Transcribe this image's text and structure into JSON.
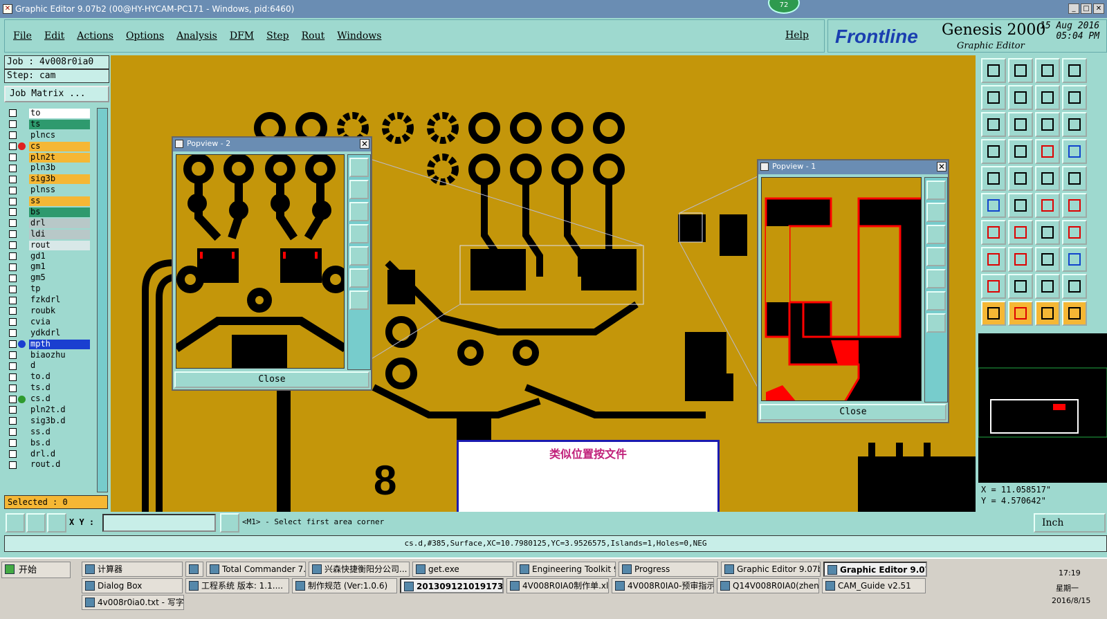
{
  "window": {
    "title": "Graphic Editor 9.07b2 (00@HY-HYCAM-PC171 - Windows, pid:6460)",
    "badge": "72"
  },
  "menu": {
    "items": [
      "File",
      "Edit",
      "Actions",
      "Options",
      "Analysis",
      "DFM",
      "Step",
      "Rout",
      "Windows"
    ],
    "help": "Help"
  },
  "brand": {
    "logo": "Frontline",
    "product": "Genesis 2000",
    "subtitle": "Graphic Editor",
    "date": "15 Aug 2016",
    "time": "05:04 PM"
  },
  "job": {
    "job_label": "Job : 4v008r0ia0",
    "step_label": "Step: cam",
    "matrix_button": "Job Matrix ..."
  },
  "layers": [
    {
      "name": "to",
      "color": "#ffffff",
      "dot": ""
    },
    {
      "name": "ts",
      "color": "#2e9a6e",
      "dot": ""
    },
    {
      "name": "plncs",
      "color": "#9ed9cf",
      "dot": ""
    },
    {
      "name": "cs",
      "color": "#f5b735",
      "dot": "#e02020"
    },
    {
      "name": "pln2t",
      "color": "#f5b735",
      "dot": ""
    },
    {
      "name": "pln3b",
      "color": "#9ed9cf",
      "dot": ""
    },
    {
      "name": "sig3b",
      "color": "#f5b735",
      "dot": ""
    },
    {
      "name": "plnss",
      "color": "#9ed9cf",
      "dot": ""
    },
    {
      "name": "ss",
      "color": "#f5b735",
      "dot": ""
    },
    {
      "name": "bs",
      "color": "#2e9a6e",
      "dot": ""
    },
    {
      "name": "drl",
      "color": "#b8c8c8",
      "dot": ""
    },
    {
      "name": "ldi",
      "color": "#b8c8c8",
      "dot": ""
    },
    {
      "name": "rout",
      "color": "#d8e8e8",
      "dot": ""
    },
    {
      "name": "gd1",
      "color": "#9ed9cf",
      "dot": ""
    },
    {
      "name": "gm1",
      "color": "#9ed9cf",
      "dot": ""
    },
    {
      "name": "gm5",
      "color": "#9ed9cf",
      "dot": ""
    },
    {
      "name": "tp",
      "color": "#9ed9cf",
      "dot": ""
    },
    {
      "name": "fzkdrl",
      "color": "#9ed9cf",
      "dot": ""
    },
    {
      "name": "roubk",
      "color": "#9ed9cf",
      "dot": ""
    },
    {
      "name": "cvia",
      "color": "#9ed9cf",
      "dot": ""
    },
    {
      "name": "ydkdrl",
      "color": "#9ed9cf",
      "dot": ""
    },
    {
      "name": "mpth",
      "color": "#1a3fd0",
      "dot": "#1a3fd0"
    },
    {
      "name": "biaozhu",
      "color": "#9ed9cf",
      "dot": ""
    },
    {
      "name": "d",
      "color": "#9ed9cf",
      "dot": ""
    },
    {
      "name": "to.d",
      "color": "#9ed9cf",
      "dot": ""
    },
    {
      "name": "ts.d",
      "color": "#9ed9cf",
      "dot": ""
    },
    {
      "name": "cs.d",
      "color": "#9ed9cf",
      "dot": "#2e9a2e"
    },
    {
      "name": "pln2t.d",
      "color": "#9ed9cf",
      "dot": ""
    },
    {
      "name": "sig3b.d",
      "color": "#9ed9cf",
      "dot": ""
    },
    {
      "name": "ss.d",
      "color": "#9ed9cf",
      "dot": ""
    },
    {
      "name": "bs.d",
      "color": "#9ed9cf",
      "dot": ""
    },
    {
      "name": "drl.d",
      "color": "#9ed9cf",
      "dot": ""
    },
    {
      "name": "rout.d",
      "color": "#9ed9cf",
      "dot": ""
    }
  ],
  "selected": "Selected : 0",
  "popview2": {
    "title": "Popview - 2",
    "close": "Close"
  },
  "popview1": {
    "title": "Popview - 1",
    "close": "Close"
  },
  "note": {
    "text": "类似位置按文件"
  },
  "coords": {
    "x": "X =  11.058517\"",
    "y": "Y =  4.570642\""
  },
  "cmd": {
    "xy_label": "X Y :",
    "xy_value": "",
    "prompt": "<M1> - Select first area corner",
    "unit": "Inch"
  },
  "status": "cs.d,#385,Surface,XC=10.7980125,YC=3.9526575,Islands=1,Holes=0,NEG",
  "taskbar": {
    "start": "开始",
    "row1": [
      "计算器",
      "",
      "Total Commander 7.0 ...",
      "兴森快捷衡阳分公司...",
      "get.exe",
      "Engineering Toolkit 9.0...",
      "Progress",
      "Graphic Editor 9.07b2 (...",
      "Graphic Editor 9.07b..."
    ],
    "row2": [
      "Dialog Box",
      "工程系统  版本: 1.1....",
      "制作规范 (Ver:1.0.6)",
      "20130912101917336.rt...",
      "4V008R0IA0制作单.xls...",
      "4V008R0IA0-预审指示...",
      "Q14V008R0IA0(zhengy...",
      "CAM_Guide v2.51"
    ],
    "row3": [
      "4v008r0ia0.txt - 写字板"
    ],
    "clock_time": "17:19",
    "clock_day": "星期一",
    "clock_date": "2016/8/15"
  },
  "colors": {
    "board": "#c4960a",
    "copper": "#000000",
    "highlight": "#ff0000",
    "panel": "#9ed9cf",
    "title": "#6a8db3"
  }
}
